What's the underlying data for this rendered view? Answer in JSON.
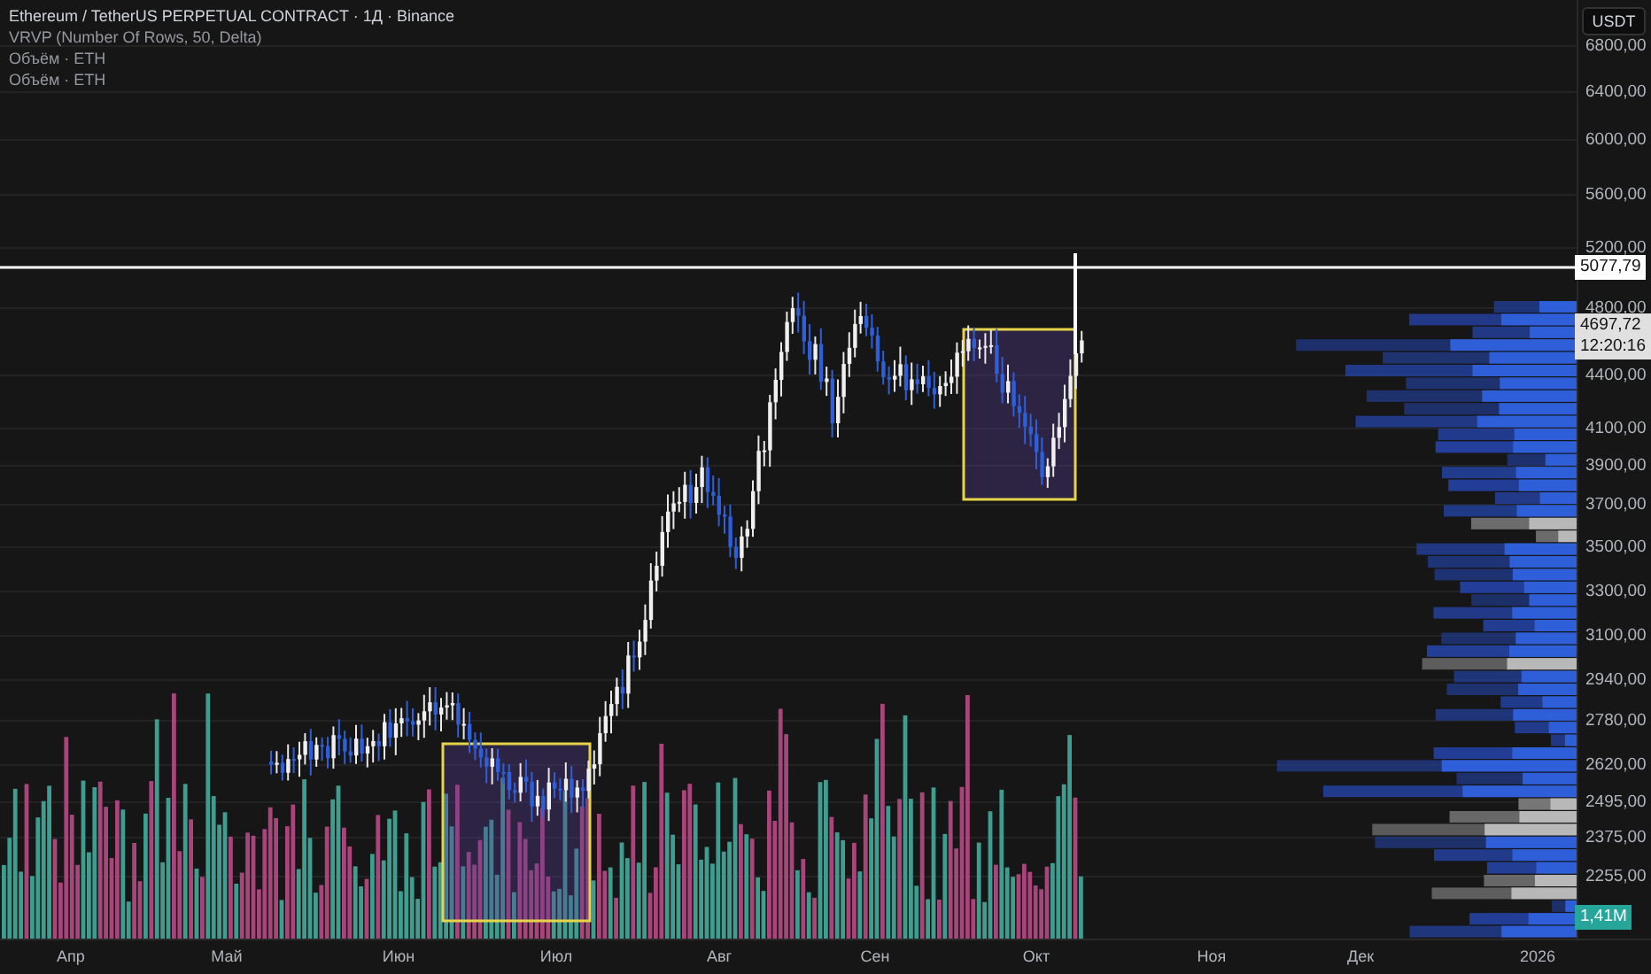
{
  "legend": [
    {
      "text": "Ethereum / TetherUS PERPETUAL CONTRACT · 1Д · Binance",
      "kind": "title"
    },
    {
      "text": "VRVP (Number Of Rows, 50, Delta)",
      "kind": "indicator"
    },
    {
      "text": "Объём · ETH",
      "kind": "indicator"
    },
    {
      "text": "Объём · ETH",
      "kind": "indicator"
    }
  ],
  "currency_button": "USDT",
  "price_axis": [
    "6800,00",
    "6400,00",
    "6000,00",
    "5600,00",
    "5200,00",
    "4800,00",
    "4400,00",
    "4100,00",
    "3900,00",
    "3700,00",
    "3500,00",
    "3300,00",
    "3100,00",
    "2940,00",
    "2780,00",
    "2620,00",
    "2495,00",
    "2375,00",
    "2255,00"
  ],
  "price_markers": [
    {
      "kind": "last",
      "text": "5077,79"
    },
    {
      "kind": "current",
      "text": "4697,72",
      "countdown": "12:20:16"
    },
    {
      "kind": "volume",
      "text": "1,41M"
    }
  ],
  "time_axis": [
    "Апр",
    "Май",
    "Июн",
    "Июл",
    "Авг",
    "Сен",
    "Окт",
    "Ноя",
    "Дек",
    "2026"
  ]
}
